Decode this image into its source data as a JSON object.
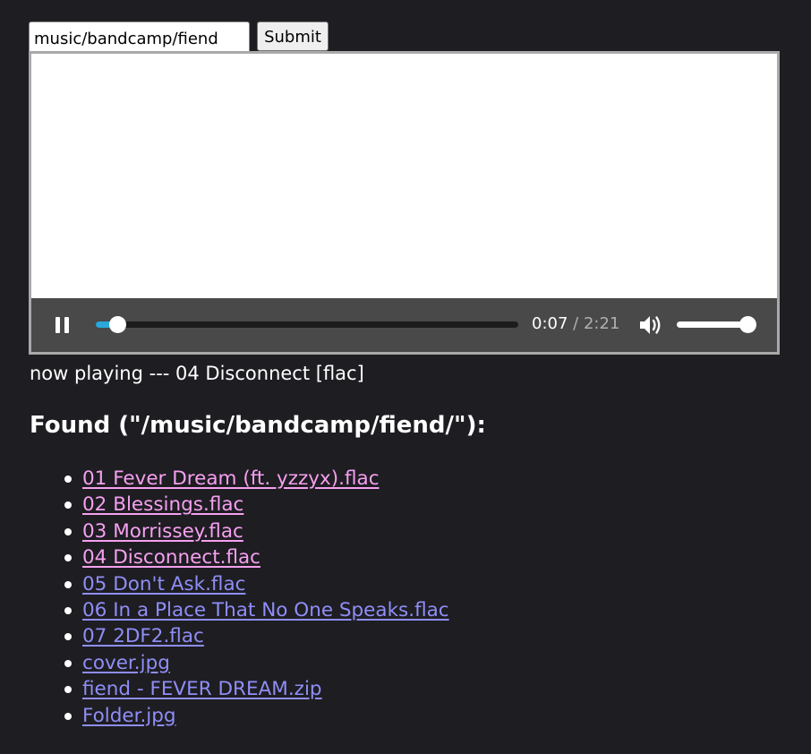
{
  "form": {
    "path_value": "music/bandcamp/fiend",
    "submit_label": "Submit"
  },
  "player": {
    "state": "playing",
    "current_time": "0:07",
    "separator": "/",
    "duration": "2:21",
    "progress_fraction": 0.05,
    "volume_fraction": 1.0,
    "accent_color": "#29a8dc"
  },
  "now_playing": "now playing --- 04 Disconnect [flac]",
  "found_heading": "Found (\"/music/bandcamp/fiend/\"):",
  "files": [
    {
      "label": "01 Fever Dream (ft. yzzyx).flac",
      "visited": true
    },
    {
      "label": "02 Blessings.flac",
      "visited": true
    },
    {
      "label": "03 Morrissey.flac",
      "visited": true
    },
    {
      "label": "04 Disconnect.flac",
      "visited": true
    },
    {
      "label": "05 Don't Ask.flac",
      "visited": false
    },
    {
      "label": "06 In a Place That No One Speaks.flac",
      "visited": false
    },
    {
      "label": "07 2DF2.flac",
      "visited": false
    },
    {
      "label": "cover.jpg",
      "visited": false
    },
    {
      "label": "fiend - FEVER DREAM.zip",
      "visited": false
    },
    {
      "label": "Folder.jpg",
      "visited": false
    }
  ],
  "colors": {
    "background": "#1e1d22",
    "link_visited": "#f5a0ef",
    "link_unvisited": "#8f8ef6"
  }
}
